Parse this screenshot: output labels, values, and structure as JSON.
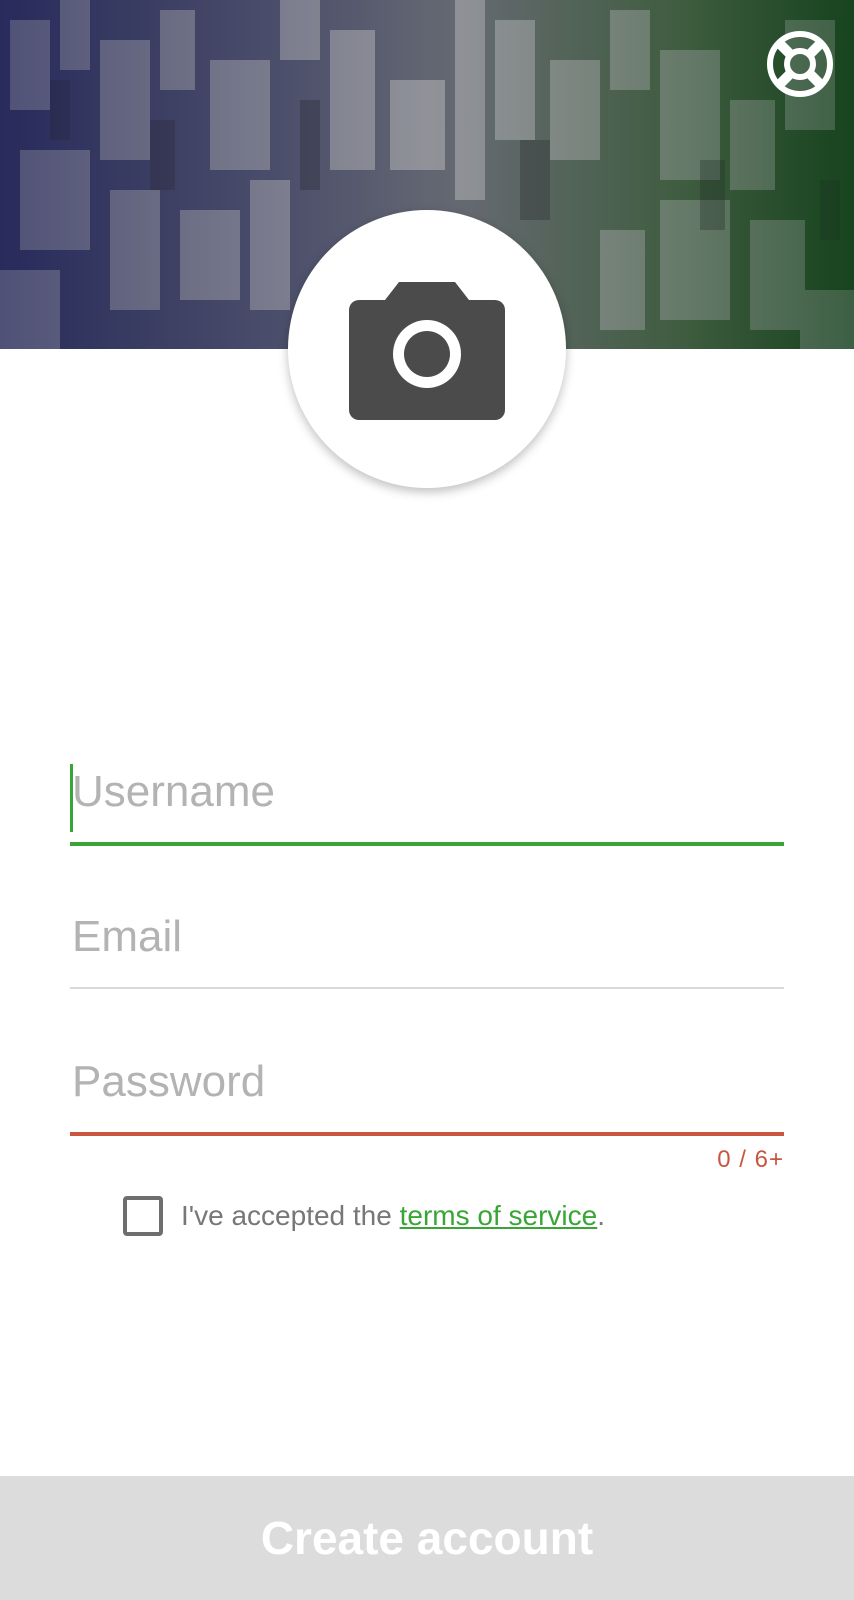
{
  "header": {
    "help_icon": "lifebuoy-icon",
    "avatar_icon": "camera-icon"
  },
  "form": {
    "username": {
      "placeholder": "Username",
      "value": ""
    },
    "email": {
      "placeholder": "Email",
      "value": ""
    },
    "password": {
      "placeholder": "Password",
      "value": "",
      "counter": "0 / 6+"
    }
  },
  "terms": {
    "prefix": "I've accepted the ",
    "link": "terms of service",
    "suffix": "."
  },
  "actions": {
    "create_label": "Create account"
  },
  "colors": {
    "accent_green": "#3aa537",
    "error_red": "#c9563e",
    "button_disabled": "#dcdcdc"
  }
}
